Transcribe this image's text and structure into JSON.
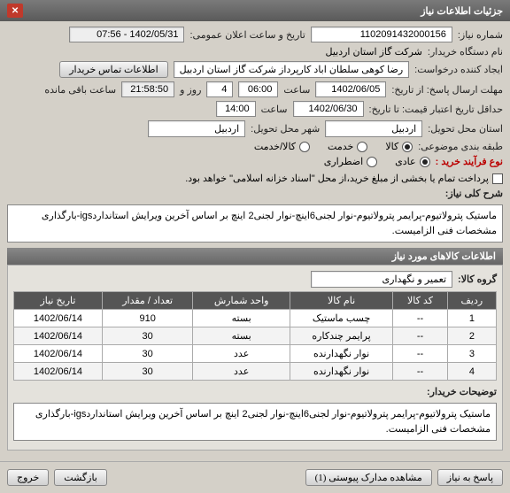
{
  "window": {
    "title": "جزئیات اطلاعات نیاز"
  },
  "header": {
    "need_no_label": "شماره نیاز:",
    "need_no": "1102091432000156",
    "announce_label": "تاریخ و ساعت اعلان عمومی:",
    "announce_value": "1402/05/31 - 07:56",
    "buyer_label": "نام دستگاه خریدار:",
    "buyer_value": "شرکت گاز استان اردبیل",
    "requester_label": "ایجاد کننده درخواست:",
    "requester_value": "رضا کوهی سلطان اباد کارپرداز شرکت گاز استان اردبیل",
    "contact_btn": "اطلاعات تماس خریدار",
    "deadline_label": "مهلت ارسال پاسخ: از تاریخ:",
    "deadline_date": "1402/06/05",
    "deadline_time_label": "ساعت",
    "deadline_time": "06:00",
    "days_label": "روز و",
    "days": "4",
    "remain_time": "21:58:50",
    "remain_label": "ساعت باقی مانده",
    "price_deadline_label": "حداقل تاریخ اعتبار قیمت: تا تاریخ:",
    "price_deadline_date": "1402/06/30",
    "price_deadline_time": "14:00",
    "province_label": "استان محل تحویل:",
    "province": "اردبیل",
    "city_label": "شهر محل تحویل:",
    "city": "اردبیل",
    "cat_label": "طبقه بندی موضوعی:",
    "cat_opts": {
      "a": "کالا",
      "b": "خدمت",
      "c": "کالا/خدمت"
    },
    "process_label": "نوع فرآیند خرید :",
    "process_opts": {
      "a": "عادی",
      "b": "اضطراری"
    },
    "pay_note_label": "",
    "pay_note": "پرداخت تمام یا بخشی از مبلغ خرید،از محل \"اسناد خزانه اسلامی\" خواهد بود."
  },
  "desc": {
    "label": "شرح کلی نیاز:",
    "text": "ماستیک پترولاتیوم-پرایمر پترولاتیوم-نوار لجنی6اینچ-نوار لجنی2 اینچ بر اساس آخرین ویرایش استانداردigs-بارگذاری مشخصات فنی الزامیست."
  },
  "goods_section": {
    "title": "اطلاعات کالاهای مورد نیاز",
    "group_label": "گروه کالا:",
    "group_value": "تعمیر و نگهداری"
  },
  "table": {
    "headers": [
      "ردیف",
      "کد کالا",
      "نام کالا",
      "واحد شمارش",
      "تعداد / مقدار",
      "تاریخ نیاز"
    ],
    "rows": [
      {
        "r": "1",
        "code": "--",
        "name": "چسب ماستیک",
        "unit": "بسته",
        "qty": "910",
        "date": "1402/06/14"
      },
      {
        "r": "2",
        "code": "--",
        "name": "پرایمر چندکاره",
        "unit": "بسته",
        "qty": "30",
        "date": "1402/06/14"
      },
      {
        "r": "3",
        "code": "--",
        "name": "نوار نگهدارنده",
        "unit": "عدد",
        "qty": "30",
        "date": "1402/06/14"
      },
      {
        "r": "4",
        "code": "--",
        "name": "نوار نگهدارنده",
        "unit": "عدد",
        "qty": "30",
        "date": "1402/06/14"
      }
    ]
  },
  "notes": {
    "label": "توضیحات خریدار:",
    "text": "ماستیک پترولاتیوم-پرایمر پترولاتیوم-نوار لجنی6اینچ-نوار لجنی2 اینچ بر اساس آخرین ویرایش استانداردigs-بارگذاری مشخصات فنی الزامیست."
  },
  "footer": {
    "respond": "پاسخ به نیاز",
    "attach": "مشاهده مدارک پیوستی (1)",
    "back": "بازگشت",
    "exit": "خروج"
  }
}
